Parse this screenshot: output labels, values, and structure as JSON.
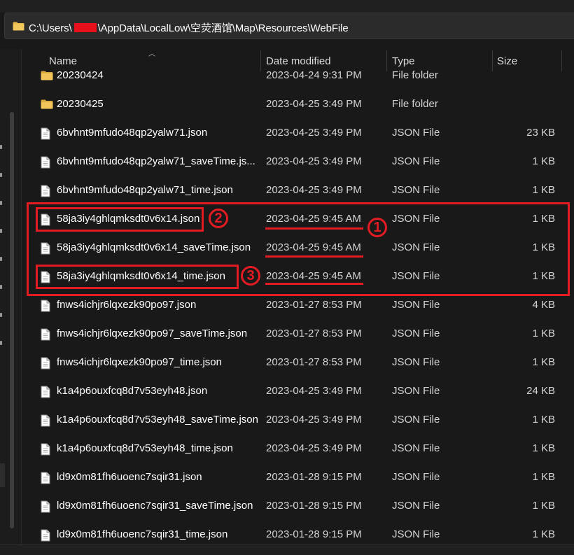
{
  "address": {
    "prefix": "C:\\Users\\",
    "suffix": "\\AppData\\LocalLow\\空荧酒馆\\Map\\Resources\\WebFile"
  },
  "columns": {
    "name": "Name",
    "date": "Date modified",
    "type": "Type",
    "size": "Size"
  },
  "files": [
    {
      "name": "20230424",
      "date": "2023-04-24 9:31 PM",
      "type": "File folder",
      "size": "",
      "icon": "folder-icon"
    },
    {
      "name": "20230425",
      "date": "2023-04-25 3:49 PM",
      "type": "File folder",
      "size": "",
      "icon": "folder-icon"
    },
    {
      "name": "6bvhnt9mfudo48qp2yalw71.json",
      "date": "2023-04-25 3:49 PM",
      "type": "JSON File",
      "size": "23 KB",
      "icon": "file-icon"
    },
    {
      "name": "6bvhnt9mfudo48qp2yalw71_saveTime.js...",
      "date": "2023-04-25 3:49 PM",
      "type": "JSON File",
      "size": "1 KB",
      "icon": "file-icon"
    },
    {
      "name": "6bvhnt9mfudo48qp2yalw71_time.json",
      "date": "2023-04-25 3:49 PM",
      "type": "JSON File",
      "size": "1 KB",
      "icon": "file-icon"
    },
    {
      "name": "58ja3iy4ghlqmksdt0v6x14.json",
      "date": "2023-04-25 9:45 AM",
      "type": "JSON File",
      "size": "1 KB",
      "icon": "file-icon"
    },
    {
      "name": "58ja3iy4ghlqmksdt0v6x14_saveTime.json",
      "date": "2023-04-25 9:45 AM",
      "type": "JSON File",
      "size": "1 KB",
      "icon": "file-icon"
    },
    {
      "name": "58ja3iy4ghlqmksdt0v6x14_time.json",
      "date": "2023-04-25 9:45 AM",
      "type": "JSON File",
      "size": "1 KB",
      "icon": "file-icon"
    },
    {
      "name": "fnws4ichjr6lqxezk90po97.json",
      "date": "2023-01-27 8:53 PM",
      "type": "JSON File",
      "size": "4 KB",
      "icon": "file-icon"
    },
    {
      "name": "fnws4ichjr6lqxezk90po97_saveTime.json",
      "date": "2023-01-27 8:53 PM",
      "type": "JSON File",
      "size": "1 KB",
      "icon": "file-icon"
    },
    {
      "name": "fnws4ichjr6lqxezk90po97_time.json",
      "date": "2023-01-27 8:53 PM",
      "type": "JSON File",
      "size": "1 KB",
      "icon": "file-icon"
    },
    {
      "name": "k1a4p6ouxfcq8d7v53eyh48.json",
      "date": "2023-04-25 3:49 PM",
      "type": "JSON File",
      "size": "24 KB",
      "icon": "file-icon"
    },
    {
      "name": "k1a4p6ouxfcq8d7v53eyh48_saveTime.json",
      "date": "2023-04-25 3:49 PM",
      "type": "JSON File",
      "size": "1 KB",
      "icon": "file-icon"
    },
    {
      "name": "k1a4p6ouxfcq8d7v53eyh48_time.json",
      "date": "2023-04-25 3:49 PM",
      "type": "JSON File",
      "size": "1 KB",
      "icon": "file-icon"
    },
    {
      "name": "ld9x0m81fh6uoenc7sqir31.json",
      "date": "2023-01-28 9:15 PM",
      "type": "JSON File",
      "size": "1 KB",
      "icon": "file-icon"
    },
    {
      "name": "ld9x0m81fh6uoenc7sqir31_saveTime.json",
      "date": "2023-01-28 9:15 PM",
      "type": "JSON File",
      "size": "1 KB",
      "icon": "file-icon"
    },
    {
      "name": "ld9x0m81fh6uoenc7sqir31_time.json",
      "date": "2023-01-28 9:15 PM",
      "type": "JSON File",
      "size": "1 KB",
      "icon": "file-icon"
    }
  ],
  "annotations": {
    "marker_1": "1",
    "marker_2": "2",
    "marker_3": "3",
    "color": "#e31b23"
  },
  "colors": {
    "background": "#191919",
    "folder": "#e8b84a",
    "redaction": "#e8101a"
  }
}
